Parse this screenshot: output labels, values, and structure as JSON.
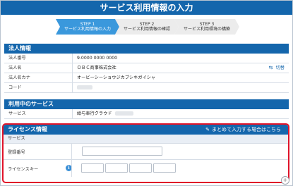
{
  "title": "サービス利用情報の入力",
  "steps": [
    {
      "num": "STEP 1",
      "label": "サービス利用情報の入力",
      "active": true
    },
    {
      "num": "STEP 2",
      "label": "サービス利用情報の確認",
      "active": false
    },
    {
      "num": "STEP 3",
      "label": "サービス利用環境の構築",
      "active": false
    }
  ],
  "corp": {
    "heading": "法人情報",
    "rows": [
      {
        "label": "法人番号",
        "value": "9.0000 0000 0000"
      },
      {
        "label": "法人名",
        "value": "ＯＢＣ商事株式会社"
      },
      {
        "label": "法人名カナ",
        "value": "オービーシーショウジカブシキガイシャ"
      },
      {
        "label": "コード",
        "value": ""
      }
    ],
    "switch_label": "切替"
  },
  "service": {
    "heading": "利用中のサービス",
    "label": "サービス",
    "value": "給与奉行クラウド"
  },
  "license": {
    "heading": "ライセンス情報",
    "bulk_link": "まとめて入力する場合はこちら",
    "service_label": "サービス",
    "reg_label": "登録番号",
    "key_label": "ライセンスキー",
    "info_icon": "i"
  },
  "colors": {
    "primary": "#1466ac",
    "highlight": "#e0142a",
    "step_active": "#3a98dc",
    "step_inactive": "#ececec"
  }
}
